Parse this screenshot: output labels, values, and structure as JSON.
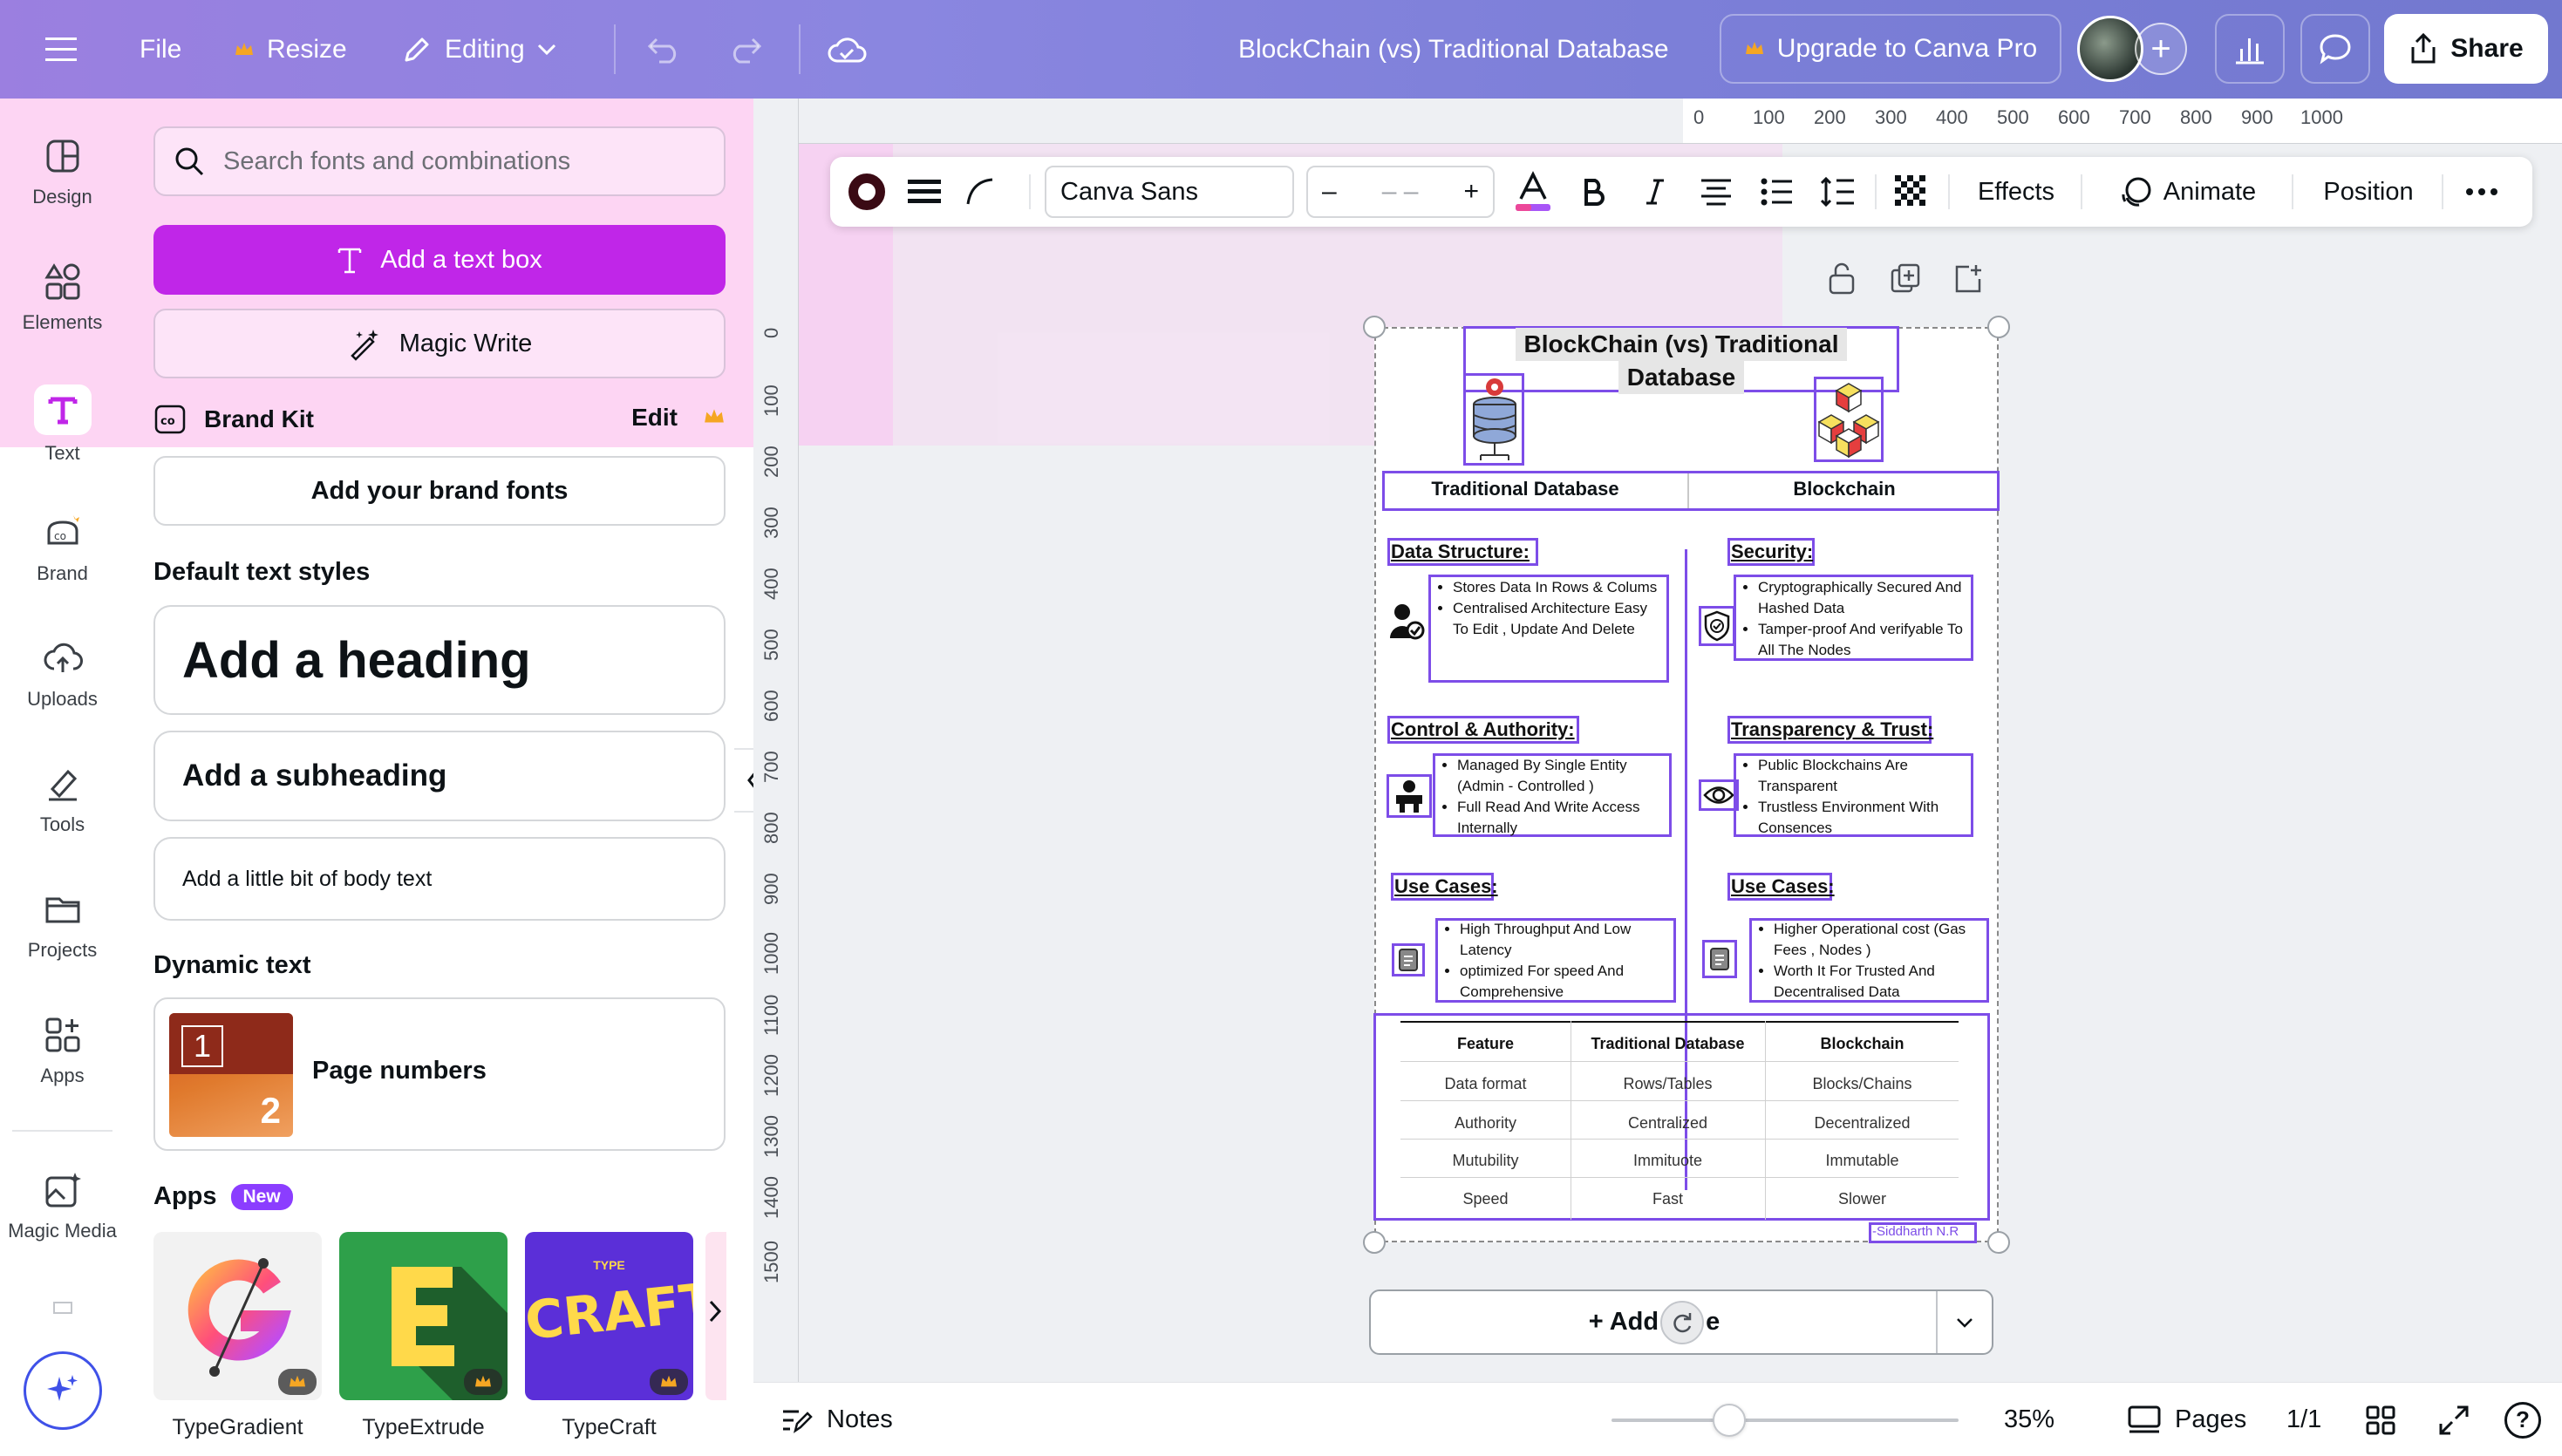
{
  "topbar": {
    "file": "File",
    "resize": "Resize",
    "editing": "Editing",
    "doc_title": "BlockChain (vs) Traditional Database",
    "upgrade": "Upgrade to Canva Pro",
    "share": "Share"
  },
  "rail": {
    "items": [
      {
        "label": "Design",
        "icon": "design-icon"
      },
      {
        "label": "Elements",
        "icon": "elements-icon"
      },
      {
        "label": "Text",
        "icon": "text-icon"
      },
      {
        "label": "Brand",
        "icon": "brand-icon"
      },
      {
        "label": "Uploads",
        "icon": "uploads-icon"
      },
      {
        "label": "Tools",
        "icon": "tools-icon"
      },
      {
        "label": "Projects",
        "icon": "projects-icon"
      },
      {
        "label": "Apps",
        "icon": "apps-icon"
      },
      {
        "label": "Magic Media",
        "icon": "magic-media-icon"
      }
    ]
  },
  "panel": {
    "search_placeholder": "Search fonts and combinations",
    "add_textbox": "Add a text box",
    "magic_write": "Magic Write",
    "brand_kit": "Brand Kit",
    "brand_edit": "Edit",
    "add_brand_fonts": "Add your brand fonts",
    "default_styles": "Default text styles",
    "heading": "Add a heading",
    "subheading": "Add a subheading",
    "body": "Add a little bit of body text",
    "dynamic_text": "Dynamic text",
    "page_numbers": "Page numbers",
    "pn_thumb_1": "1",
    "pn_thumb_2": "2",
    "apps_title": "Apps",
    "apps_new": "New",
    "apps": [
      {
        "label": "TypeGradient"
      },
      {
        "label": "TypeExtrude"
      },
      {
        "label": "TypeCraft"
      }
    ],
    "typecraft_logo": "CRAFT",
    "typecraft_logo_top": "TYPE"
  },
  "rulers": {
    "top": [
      "0",
      "100",
      "200",
      "300",
      "400",
      "500",
      "600",
      "700",
      "800",
      "900",
      "1000"
    ],
    "left": [
      "0",
      "100",
      "200",
      "300",
      "400",
      "500",
      "600",
      "700",
      "800",
      "900",
      "1000",
      "1100",
      "1200",
      "1300",
      "1400",
      "1500"
    ]
  },
  "toolbar": {
    "font": "Canva Sans",
    "size_minus": "–",
    "size_value": "– –",
    "size_plus": "+",
    "effects": "Effects",
    "animate": "Animate",
    "position": "Position"
  },
  "design": {
    "title_line1": "BlockChain (vs) Traditional",
    "title_line2": "Database",
    "col_left": "Traditional Database",
    "col_right": "Blockchain",
    "left": [
      {
        "heading": "Data Structure:",
        "bullets": [
          "Stores Data In Rows & Colums",
          "Centralised Architecture Easy To Edit , Update And Delete"
        ]
      },
      {
        "heading": "Control & Authority:",
        "bullets": [
          "Managed By Single Entity (Admin - Controlled )",
          "Full Read And Write Access Internally"
        ]
      },
      {
        "heading": "Use Cases:",
        "bullets": [
          "High Throughput And Low Latency",
          "optimized For speed And Comprehensive"
        ]
      }
    ],
    "right": [
      {
        "heading": "Security:",
        "bullets": [
          "Cryptographically Secured And Hashed Data",
          "Tamper-proof And verifyable To All The Nodes"
        ]
      },
      {
        "heading": "Transparency & Trust:",
        "bullets": [
          "Public Blockchains Are Transparent",
          "Trustless Environment With Consences"
        ]
      },
      {
        "heading": "Use Cases:",
        "bullets": [
          "Higher Operational cost (Gas Fees , Nodes )",
          "Worth It For Trusted And Decentralised Data"
        ]
      }
    ],
    "table": {
      "headers": [
        "Feature",
        "Traditional Database",
        "Blockchain"
      ],
      "rows": [
        [
          "Data format",
          "Rows/Tables",
          "Blocks/Chains"
        ],
        [
          "Authority",
          "Centralized",
          "Decentralized"
        ],
        [
          "Mutubility",
          "Immituote",
          "Immutable"
        ],
        [
          "Speed",
          "Fast",
          "Slower"
        ]
      ]
    },
    "signature": "-Siddharth N.R"
  },
  "add_page": "+ Add",
  "add_page_tail": "e",
  "bottombar": {
    "notes": "Notes",
    "zoom_level": 0.35,
    "zoom": "35%",
    "pages": "Pages",
    "page_count": "1/1",
    "help": "?"
  },
  "colors": {
    "topbar_start": "#9b7fe0",
    "topbar_end": "#7278cf",
    "accent_purple": "#c026e8",
    "selection": "#7d4de8",
    "pink_highlight": "#fdd5f3"
  }
}
